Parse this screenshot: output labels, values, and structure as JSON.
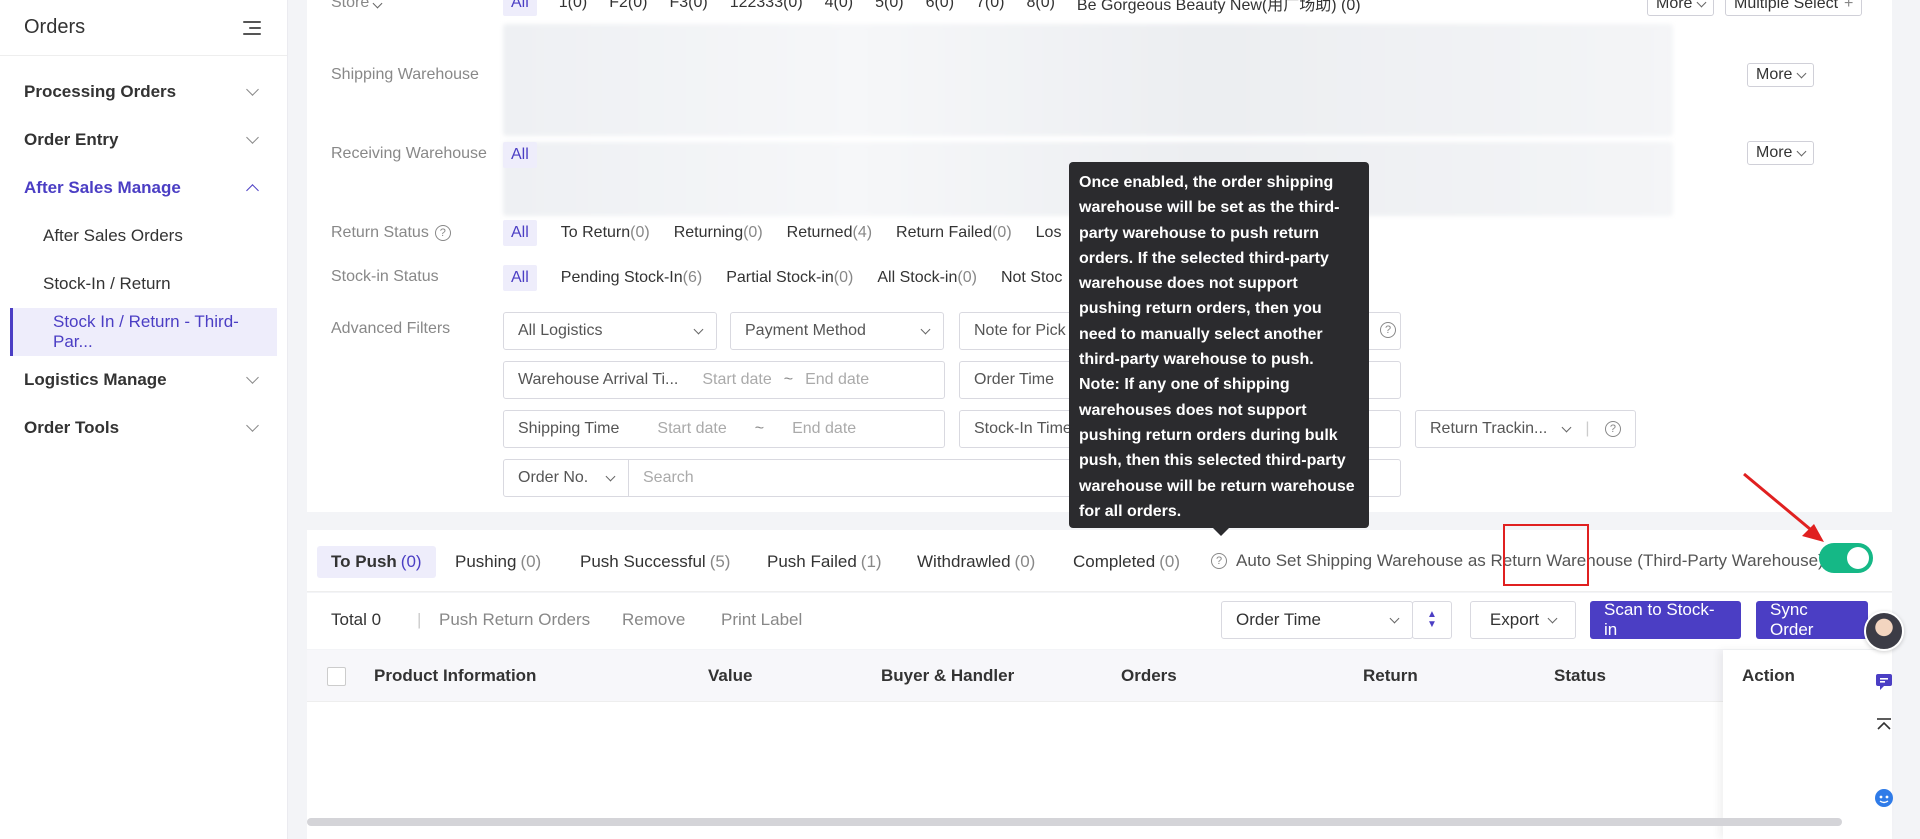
{
  "sidebar": {
    "title": "Orders",
    "items": [
      {
        "label": "Processing Orders"
      },
      {
        "label": "Order Entry"
      },
      {
        "label": "After Sales Manage"
      },
      {
        "label": "Logistics Manage"
      },
      {
        "label": "Order Tools"
      }
    ],
    "sub_items": [
      {
        "label": "After Sales Orders"
      },
      {
        "label": "Stock-In / Return"
      },
      {
        "label": "Stock In / Return - Third-Par..."
      }
    ]
  },
  "filters": {
    "store_label": "Store",
    "store_all": "All",
    "store_options": [
      "1(0)",
      "F2(0)",
      "F3(0)",
      "122333(0)",
      "4(0)",
      "5(0)",
      "6(0)",
      "7(0)",
      "8(0)",
      "Be Gorgeous Beauty New(用广场助) (0)"
    ],
    "more": "More",
    "multiple_select": "Multiple Select",
    "shipping_warehouse_label": "Shipping Warehouse",
    "receiving_warehouse_label": "Receiving Warehouse",
    "receiving_all": "All",
    "return_status_label": "Return Status",
    "return_status_all": "All",
    "return_status_options": [
      {
        "label": "To Return",
        "count": "(0)"
      },
      {
        "label": "Returning",
        "count": "(0)"
      },
      {
        "label": "Returned",
        "count": "(4)"
      },
      {
        "label": "Return Failed",
        "count": "(0)"
      },
      {
        "label": "Los",
        "count": ""
      }
    ],
    "stockin_status_label": "Stock-in Status",
    "stockin_all": "All",
    "stockin_options": [
      {
        "label": "Pending Stock-In",
        "count": "(6)"
      },
      {
        "label": "Partial Stock-in",
        "count": "(0)"
      },
      {
        "label": "All Stock-in",
        "count": "(0)"
      },
      {
        "label": "Not Stoc",
        "count": ""
      }
    ],
    "advanced_label": "Advanced Filters",
    "all_logistics": "All Logistics",
    "payment_method": "Payment Method",
    "note_for_pick": "Note for Pick",
    "warehouse_arrival": "Warehouse Arrival Ti...",
    "start_date": "Start date",
    "end_date": "End date",
    "tilde": "~",
    "order_time": "Order Time",
    "shipping_time": "Shipping Time",
    "stockin_time": "Stock-In Time",
    "return_tracking": "Return Trackin...",
    "order_no": "Order No.",
    "search_placeholder": "Search"
  },
  "tooltip": {
    "text1": "Once enabled, the order shipping warehouse will be set as the third-party warehouse to push return orders. If the selected third-party warehouse does not support pushing return orders, then you need to manually select another third-party warehouse to push.",
    "text2": "Note: If any one of shipping warehouses does not support pushing return orders during bulk push, then this selected third-party warehouse will be return warehouse for all orders."
  },
  "tabs": [
    {
      "label": "To Push",
      "count": "(0)"
    },
    {
      "label": "Pushing",
      "count": "(0)"
    },
    {
      "label": "Push Successful",
      "count": "(5)"
    },
    {
      "label": "Push Failed",
      "count": "(1)"
    },
    {
      "label": "Withdrawled",
      "count": "(0)"
    },
    {
      "label": "Completed",
      "count": "(0)"
    }
  ],
  "autoset_label": "Auto Set Shipping Warehouse as Return Warehouse (Third-Party Warehouse)",
  "toggle_on": true,
  "action_bar": {
    "total": "Total 0",
    "push_return": "Push Return Orders",
    "remove": "Remove",
    "print_label": "Print Label",
    "sort_select": "Order Time",
    "export": "Export",
    "scan": "Scan to Stock-in",
    "sync": "Sync Order"
  },
  "table": {
    "columns": [
      "Product Information",
      "Value",
      "Buyer & Handler",
      "Orders",
      "Return",
      "Status",
      "Action"
    ]
  }
}
